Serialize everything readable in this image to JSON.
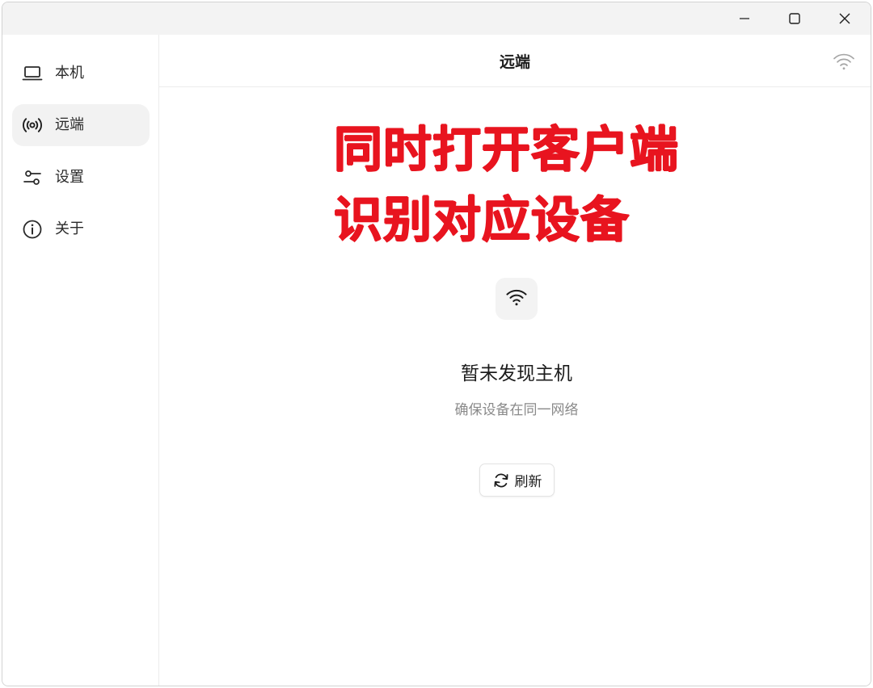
{
  "window_controls": {
    "minimize_icon": "minimize-icon",
    "maximize_icon": "maximize-icon",
    "close_icon": "close-icon"
  },
  "sidebar": {
    "items": [
      {
        "label": "本机",
        "icon": "laptop-icon",
        "active": false
      },
      {
        "label": "远端",
        "icon": "broadcast-icon",
        "active": true
      },
      {
        "label": "设置",
        "icon": "sliders-icon",
        "active": false
      },
      {
        "label": "关于",
        "icon": "info-icon",
        "active": false
      }
    ]
  },
  "header": {
    "title": "远端",
    "status_icon": "wifi-icon"
  },
  "overlay": {
    "line1": "同时打开客户端",
    "line2": "识别对应设备",
    "color": "#e8141f"
  },
  "empty_state": {
    "icon": "wifi-icon",
    "title": "暂未发现主机",
    "subtitle": "确保设备在同一网络",
    "refresh_label": "刷新",
    "refresh_icon": "refresh-icon"
  },
  "colors": {
    "titlebar": "#f3f3f3",
    "active_nav": "#f2f2f2",
    "text_primary": "#1c1c1c",
    "text_secondary": "#8a8a8a"
  }
}
